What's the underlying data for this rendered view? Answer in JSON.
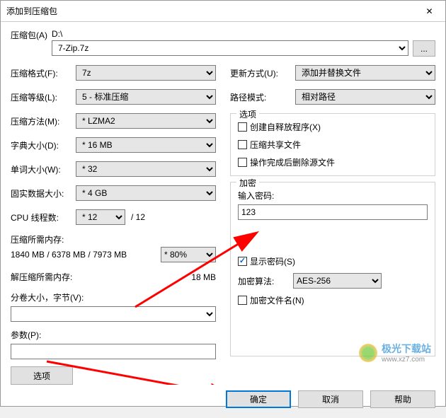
{
  "title": "添加到压缩包",
  "archive": {
    "label": "压缩包(A)",
    "path": "D:\\",
    "file": "7-Zip.7z",
    "browse": "..."
  },
  "left": {
    "format": {
      "label": "压缩格式(F):",
      "value": "7z"
    },
    "level": {
      "label": "压缩等级(L):",
      "value": "5 - 标准压缩"
    },
    "method": {
      "label": "压缩方法(M):",
      "value": "* LZMA2"
    },
    "dict": {
      "label": "字典大小(D):",
      "value": "* 16 MB"
    },
    "word": {
      "label": "单词大小(W):",
      "value": "* 32"
    },
    "solid": {
      "label": "固实数据大小:",
      "value": "* 4 GB"
    },
    "cpu": {
      "label": "CPU 线程数:",
      "value": "* 12",
      "total": "/ 12"
    },
    "memcomp": {
      "label": "压缩所需内存:",
      "value": "1840 MB / 6378 MB / 7973 MB",
      "pct": "* 80%"
    },
    "memdecomp": {
      "label": "解压缩所需内存:",
      "value": "18 MB"
    },
    "volume": {
      "label": "分卷大小，字节(V):",
      "value": ""
    },
    "params": {
      "label": "参数(P):",
      "value": ""
    },
    "options_btn": "选项"
  },
  "right": {
    "update": {
      "label": "更新方式(U):",
      "value": "添加并替换文件"
    },
    "pathmode": {
      "label": "路径模式:",
      "value": "相对路径"
    },
    "options": {
      "label": "选项",
      "sfx": "创建自释放程序(X)",
      "shared": "压缩共享文件",
      "delete": "操作完成后删除源文件"
    },
    "encrypt": {
      "label": "加密",
      "pwd_label": "输入密码:",
      "pwd_value": "123",
      "show": "显示密码(S)",
      "algo_label": "加密算法:",
      "algo_value": "AES-256",
      "encnames": "加密文件名(N)"
    }
  },
  "buttons": {
    "ok": "确定",
    "cancel": "取消",
    "help": "帮助"
  },
  "watermark": {
    "cn": "极光下载站",
    "url": "www.xz7.com"
  }
}
